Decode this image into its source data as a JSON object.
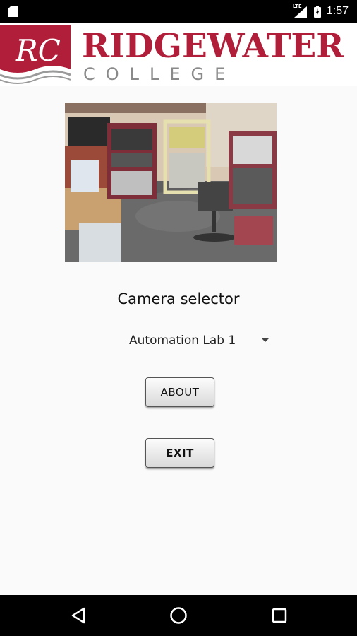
{
  "status_bar": {
    "network_label": "LTE",
    "time": "1:57"
  },
  "logo": {
    "monogram": "RC",
    "name": "RIDGEWATER",
    "subname": "COLLEGE",
    "brand_color": "#b01e3a"
  },
  "main": {
    "camera_image_alt": "Automation lab camera view",
    "selector_title": "Camera selector",
    "selected_camera": "Automation Lab 1",
    "about_label": "ABOUT",
    "exit_label": "EXIT"
  },
  "nav_bar": {
    "back_icon": "back-triangle-icon",
    "home_icon": "home-circle-icon",
    "recents_icon": "recents-square-icon"
  }
}
